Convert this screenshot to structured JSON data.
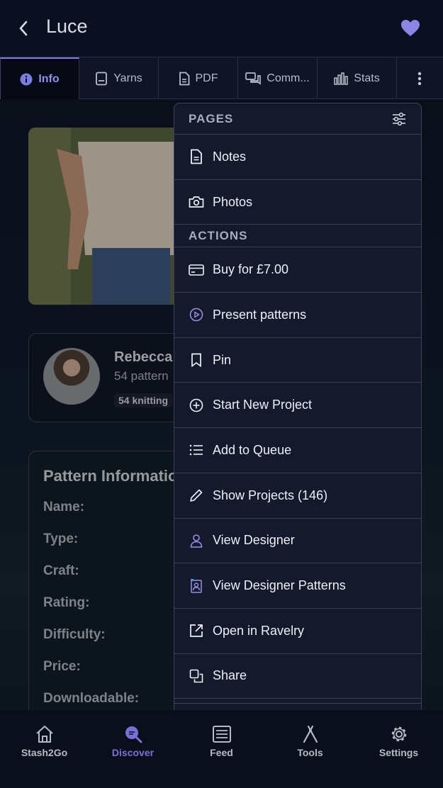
{
  "header": {
    "title": "Luce"
  },
  "tabs": [
    {
      "label": "Info",
      "icon": "info-icon"
    },
    {
      "label": "Yarns",
      "icon": "book-icon"
    },
    {
      "label": "PDF",
      "icon": "document-icon"
    },
    {
      "label": "Comm...",
      "icon": "comments-icon"
    },
    {
      "label": "Stats",
      "icon": "chart-icon"
    }
  ],
  "designer": {
    "name": "Rebecca",
    "count": "54 pattern",
    "badge": "54 knitting"
  },
  "pattern_info": {
    "title": "Pattern Informatio",
    "labels": [
      "Name:",
      "Type:",
      "Craft:",
      "Rating:",
      "Difficulty:",
      "Price:",
      "Downloadable:"
    ]
  },
  "menu": {
    "pages_header": "PAGES",
    "pages": [
      {
        "label": "Notes",
        "icon": "note-icon"
      },
      {
        "label": "Photos",
        "icon": "camera-icon"
      }
    ],
    "actions_header": "ACTIONS",
    "actions": [
      {
        "label": "Buy for £7.00",
        "icon": "credit-card-icon"
      },
      {
        "label": "Present patterns",
        "icon": "play-icon"
      },
      {
        "label": "Pin",
        "icon": "bookmark-icon"
      },
      {
        "label": "Start New Project",
        "icon": "plus-circle-icon"
      },
      {
        "label": "Add to Queue",
        "icon": "list-icon"
      },
      {
        "label": "Show Projects (146)",
        "icon": "pencil-icon"
      },
      {
        "label": "View Designer",
        "icon": "user-icon"
      },
      {
        "label": "View Designer Patterns",
        "icon": "designer-patterns-icon"
      },
      {
        "label": "Open in Ravelry",
        "icon": "external-link-icon"
      },
      {
        "label": "Share",
        "icon": "share-icon"
      }
    ]
  },
  "bottom_nav": [
    {
      "label": "Stash2Go",
      "icon": "home-icon"
    },
    {
      "label": "Discover",
      "icon": "discover-icon"
    },
    {
      "label": "Feed",
      "icon": "feed-icon"
    },
    {
      "label": "Tools",
      "icon": "tools-icon"
    },
    {
      "label": "Settings",
      "icon": "gear-icon"
    }
  ],
  "colors": {
    "accent": "#7b70d8",
    "heart": "#8b86e6",
    "menu_bg": "#141a2c"
  }
}
